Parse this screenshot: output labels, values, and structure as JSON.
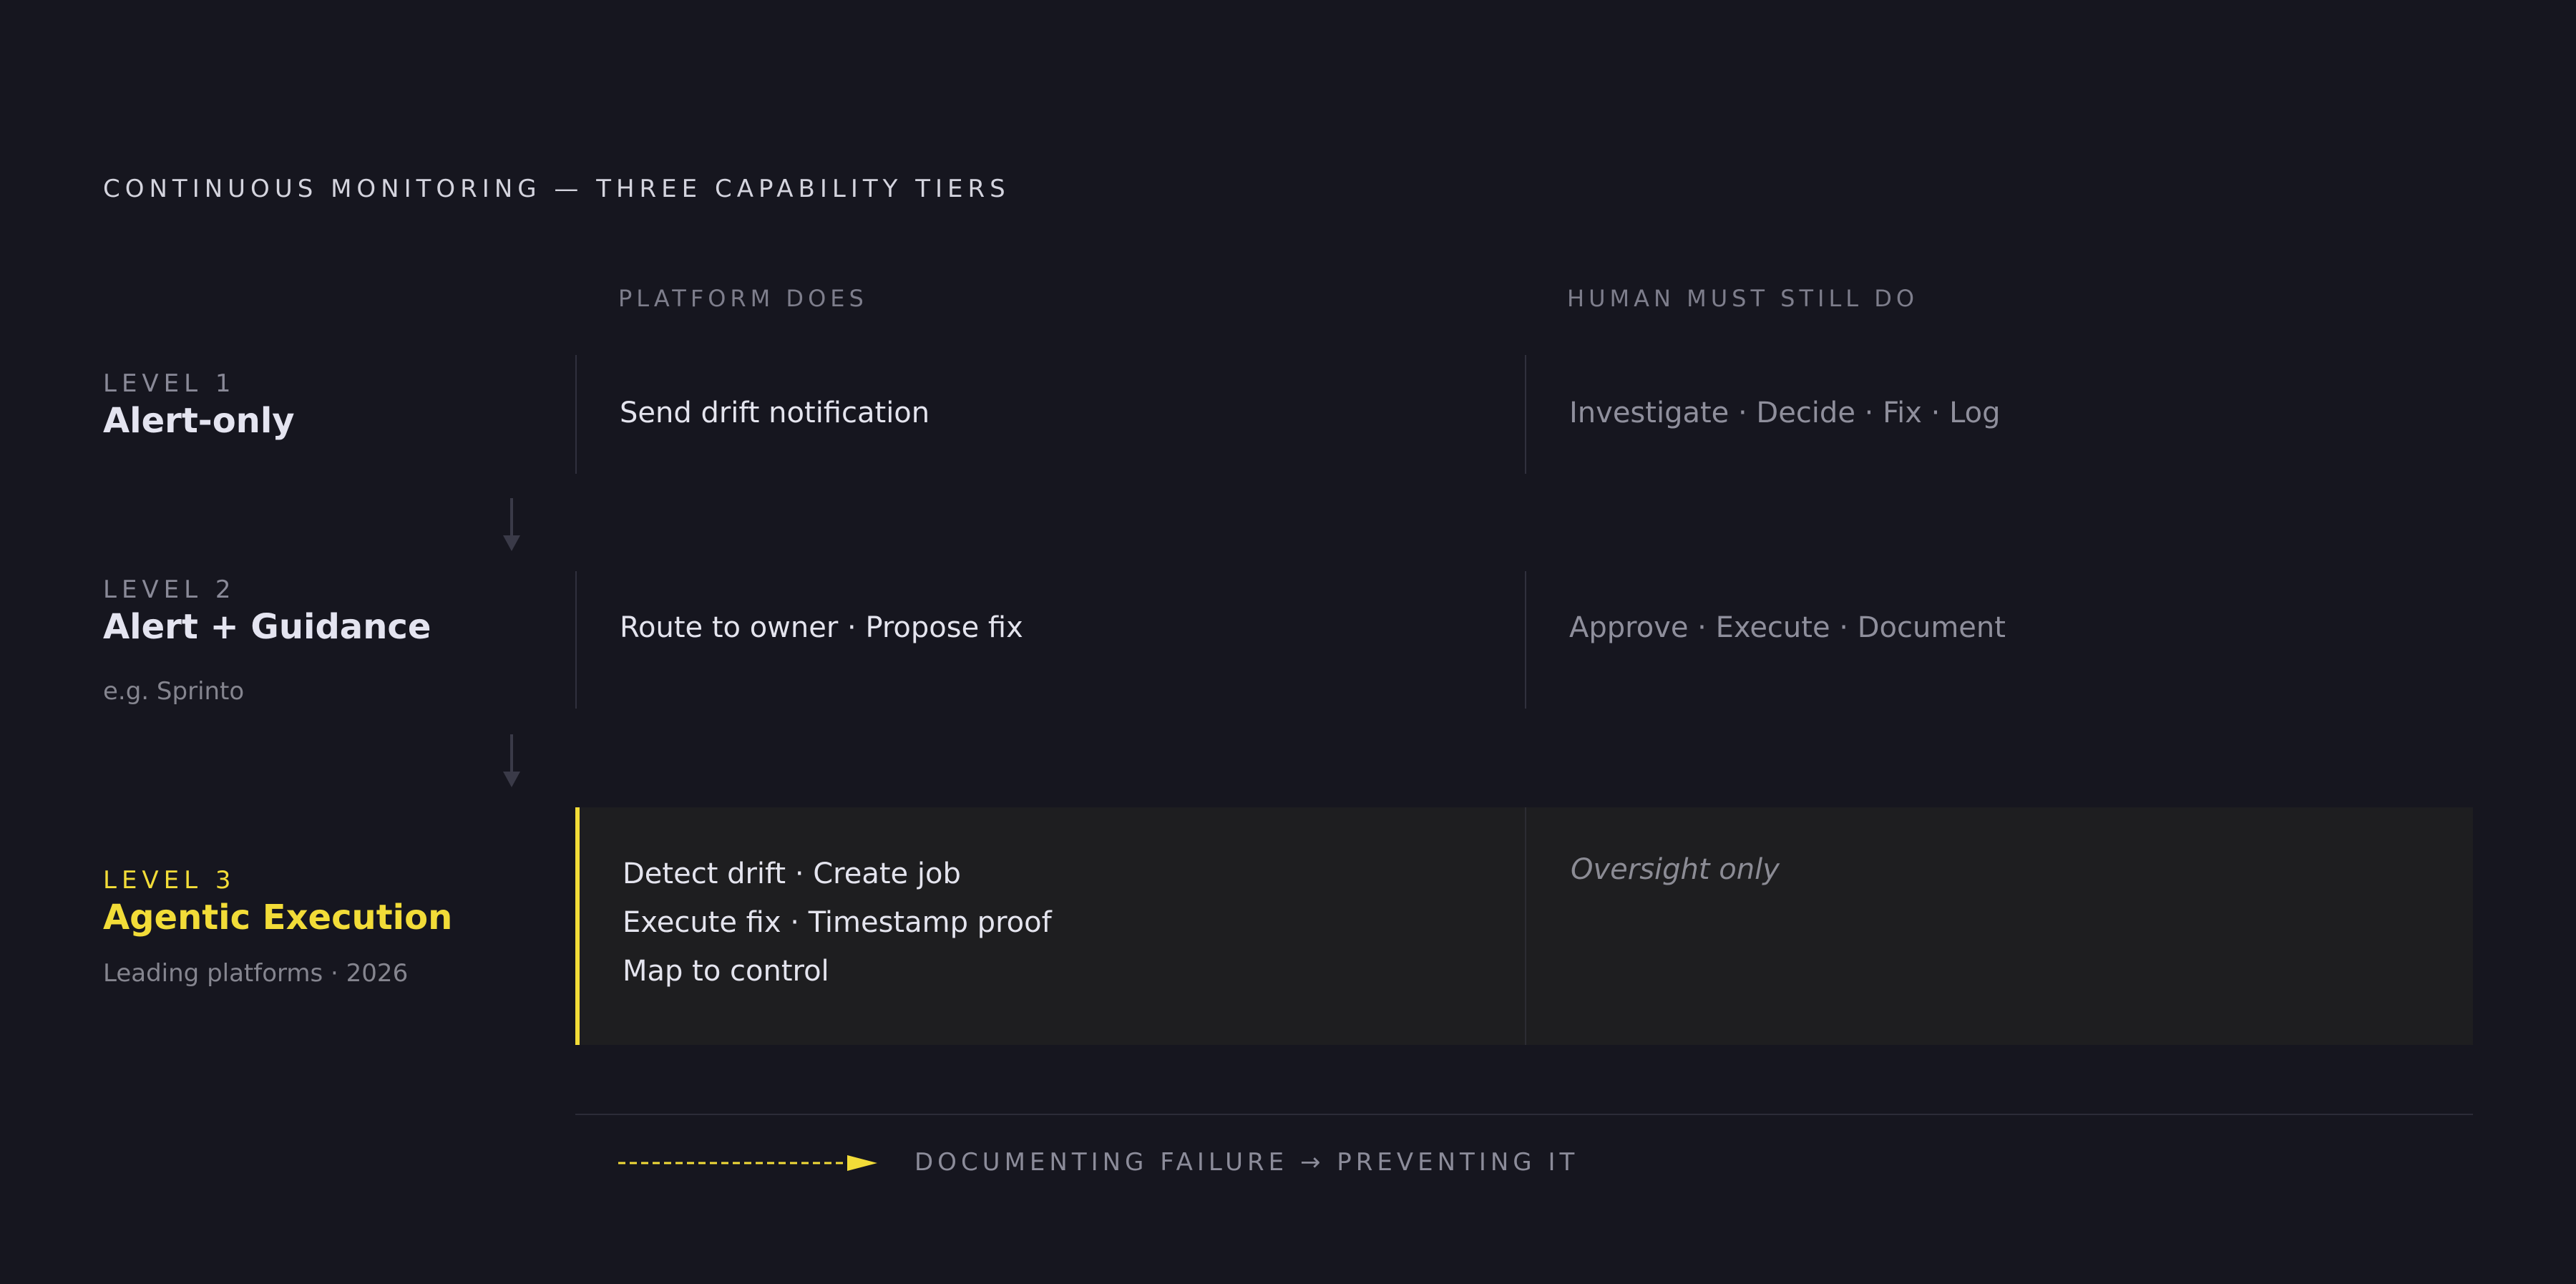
{
  "title": "CONTINUOUS MONITORING — THREE CAPABILITY TIERS",
  "columns": {
    "platform": "PLATFORM DOES",
    "human": "HUMAN MUST STILL DO"
  },
  "levels": [
    {
      "kicker": "LEVEL 1",
      "name": "Alert-only",
      "note": "",
      "platform": [
        "Send drift notification"
      ],
      "human": "Investigate · Decide · Fix · Log"
    },
    {
      "kicker": "LEVEL 2",
      "name": "Alert + Guidance",
      "note": "e.g. Sprinto",
      "platform": [
        "Route to owner · Propose fix"
      ],
      "human": "Approve · Execute · Document"
    },
    {
      "kicker": "LEVEL 3",
      "name": "Agentic Execution",
      "note": "Leading platforms · 2026",
      "platform": [
        "Detect drift · Create job",
        "Execute fix · Timestamp proof",
        "Map to control"
      ],
      "human": "Oversight only"
    }
  ],
  "footer": {
    "label": "DOCUMENTING FAILURE → PREVENTING IT"
  },
  "colors": {
    "background": "#16161f",
    "accent": "#f2dc38",
    "tier3_panel": "#1e1e20"
  }
}
